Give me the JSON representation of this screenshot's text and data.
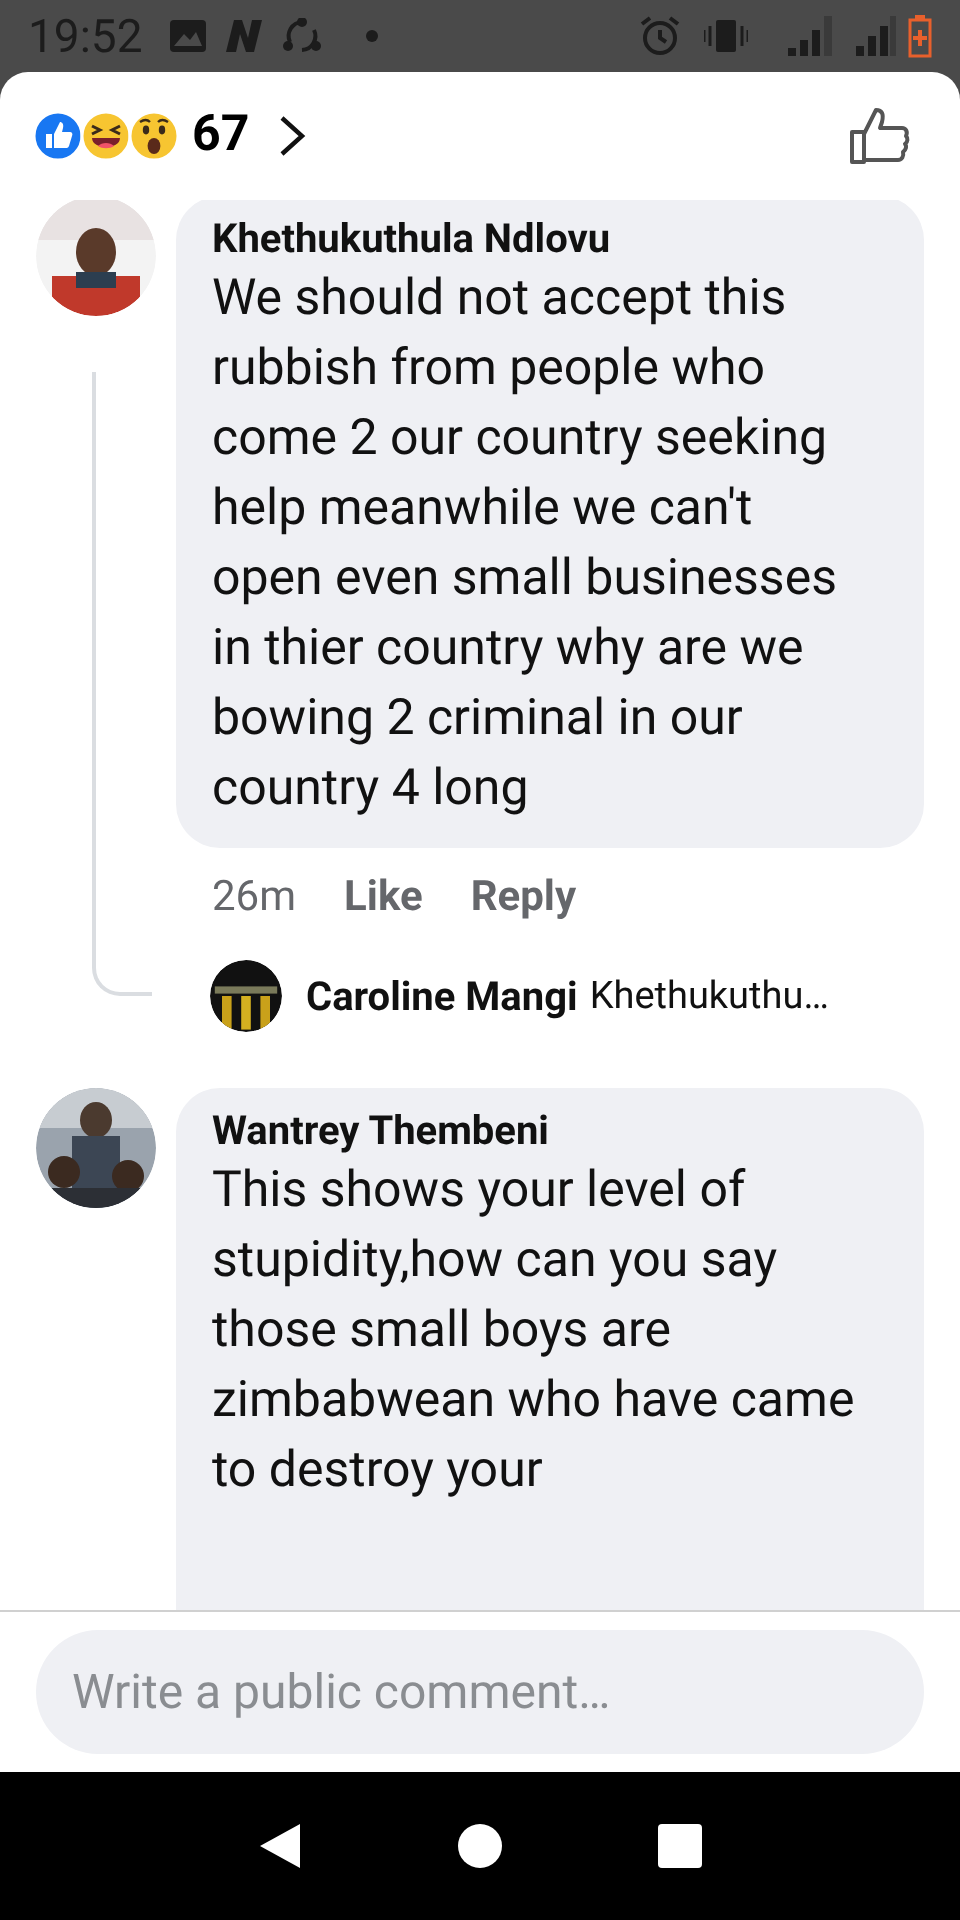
{
  "status_bar": {
    "time": "19:52"
  },
  "reactions": {
    "count": "67"
  },
  "comments": [
    {
      "author": "Khethukuthula Ndlovu",
      "text": "We should not accept this rubbish from people who come 2 our country seeking help meanwhile we can't open even small businesses in thier country why are we bowing 2 criminal in our country 4 long",
      "time": "26m",
      "actions": [
        "Like",
        "Reply"
      ],
      "replies": [
        {
          "author": "Caroline Mangi",
          "preview": "Khethukuthu…"
        }
      ]
    },
    {
      "author": "Wantrey Thembeni",
      "text": "This shows your level of stupidity,how can you say those small boys are zimbabwean who have came to destroy your"
    }
  ],
  "composer": {
    "placeholder": "Write a public comment…"
  }
}
